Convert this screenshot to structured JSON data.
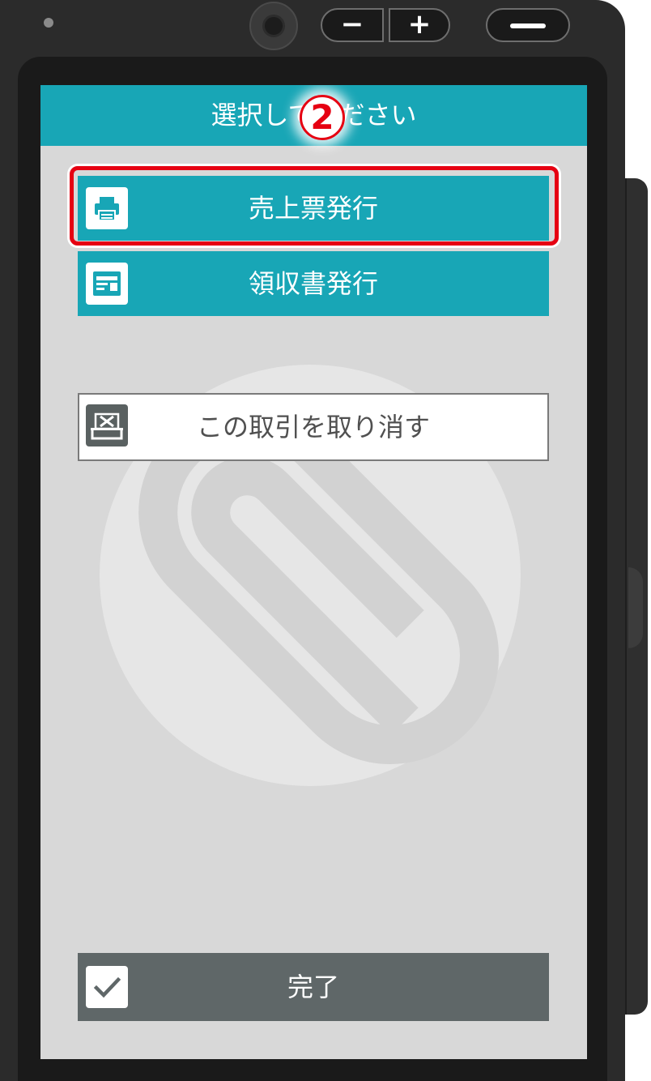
{
  "screen": {
    "header_title": "選択してください",
    "step_badge": "2"
  },
  "device": {
    "vol_minus_label": "−",
    "vol_plus_label": "+"
  },
  "actions": {
    "sales_slip_label": "売上票発行",
    "receipt_label": "領収書発行",
    "cancel_label": "この取引を取り消す",
    "done_label": "完了"
  },
  "icons": {
    "sales_slip": "printer-icon",
    "receipt": "receipt-icon",
    "cancel": "cancel-receipt-icon",
    "done": "checkmark-icon",
    "watermark": "paperclip-logo-icon"
  },
  "colors": {
    "accent": "#18a6b6",
    "highlight": "#e60012",
    "done_button": "#5f6768",
    "screen_bg": "#d8d8d8"
  }
}
